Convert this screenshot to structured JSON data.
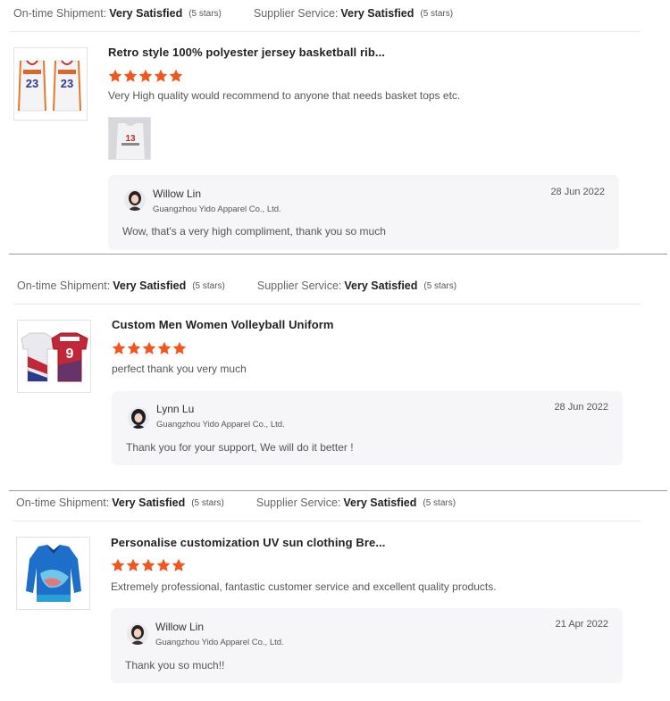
{
  "colors": {
    "star": "#f0561e",
    "divider": "#9a9a9a",
    "reply_bg": "#f6f6f8"
  },
  "reviews": [
    {
      "shipment_label": "On-time Shipment:",
      "shipment_value": "Very Satisfied",
      "shipment_stars": "(5 stars)",
      "supplier_label": "Supplier Service:",
      "supplier_value": "Very Satisfied",
      "supplier_stars": "(5 stars)",
      "product_title": "Retro style 100% polyester jersey basketball rib...",
      "rating": 5,
      "comment": "Very High quality would recommend to anyone that needs basket tops etc.",
      "reply": {
        "name": "Willow Lin",
        "company": "Guangzhou Yido Apparel Co., Ltd.",
        "date": "28 Jun 2022",
        "text": "Wow, that's a very high compliment, thank you so much"
      }
    },
    {
      "shipment_label": "On-time Shipment:",
      "shipment_value": "Very Satisfied",
      "shipment_stars": "(5 stars)",
      "supplier_label": "Supplier Service:",
      "supplier_value": "Very Satisfied",
      "supplier_stars": "(5 stars)",
      "product_title": "Custom Men Women Volleyball Uniform",
      "rating": 5,
      "comment": "perfect thank you very much",
      "reply": {
        "name": "Lynn Lu",
        "company": "Guangzhou Yido Apparel Co., Ltd.",
        "date": "28 Jun 2022",
        "text": "Thank you for your support, We will do it better !"
      }
    },
    {
      "shipment_label": "On-time Shipment:",
      "shipment_value": "Very Satisfied",
      "shipment_stars": "(5 stars)",
      "supplier_label": "Supplier Service:",
      "supplier_value": "Very Satisfied",
      "supplier_stars": "(5 stars)",
      "product_title": "Personalise customization UV sun clothing Bre...",
      "rating": 5,
      "comment": "Extremely professional, fantastic customer service and excellent quality products.",
      "reply": {
        "name": "Willow Lin",
        "company": "Guangzhou Yido Apparel Co., Ltd.",
        "date": "21 Apr 2022",
        "text": "Thank you so much!!"
      }
    }
  ]
}
